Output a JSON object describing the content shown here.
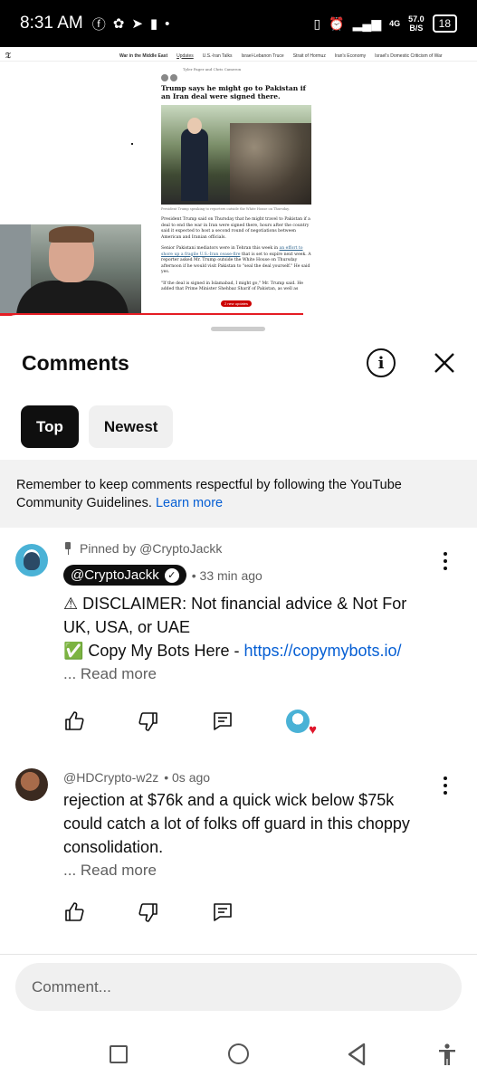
{
  "status_bar": {
    "time": "8:31 AM",
    "network": "4G",
    "speed_value": "57.0",
    "speed_unit": "B/S",
    "battery": "18"
  },
  "video": {
    "nyt_nav": [
      "War in the Middle East",
      "Updates",
      "U.S.-Iran Talks",
      "Israel-Lebanon Truce",
      "Strait of Hormuz",
      "Iran's Economy",
      "Israel's Domestic Criticism of War"
    ],
    "byline": "Tyler Pager and Chris Cameron",
    "headline": "Trump says he might go to Pakistan if an Iran deal were signed there.",
    "caption": "President Trump speaking to reporters outside the White House on Thursday.",
    "para1": "President Trump said on Thursday that he might travel to Pakistan if a deal to end the war in Iran were signed there, hours after the country said it expected to host a second round of negotiations between American and Iranian officials.",
    "para2_start": "Senior Pakistani mediators were in Tehran this week in ",
    "para2_link": "an effort to shore up a fragile U.S.-Iran cease-fire",
    "para2_end": " that is set to expire next week. A reporter asked Mr. Trump outside the White House on Thursday afternoon if he would visit Pakistan to \"seal the deal yourself.\" He said yes.",
    "para3": "\"If the deal is signed in Islamabad, I might go,\" Mr. Trump said. He added that Prime Minister Shehbaz Sharif of Pakistan, as well as",
    "new_updates": "2 new updates"
  },
  "sheet": {
    "title": "Comments",
    "chips": [
      "Top",
      "Newest"
    ],
    "notice_text": "Remember to keep comments respectful by following the YouTube Community Guidelines.",
    "notice_link": "Learn more"
  },
  "comments": [
    {
      "pinned_label": "Pinned by @CryptoJackk",
      "author": "@CryptoJackk",
      "time": "• 33 min ago",
      "line1": "⚠ DISCLAIMER: Not financial advice & Not For UK, USA, or UAE",
      "line2_prefix": "✅ Copy My Bots Here - ",
      "line2_url": "https://copymybots.io/",
      "read_more": "... Read more"
    },
    {
      "author": "@HDCrypto-w2z",
      "time": "• 0s ago",
      "text": "rejection at $76k and a quick wick below $75k could catch a lot of folks off guard in this choppy consolidation.",
      "read_more": " ... Read more"
    }
  ],
  "input": {
    "placeholder": "Comment..."
  },
  "colors": {
    "link": "#065fd4",
    "heart": "#e0162b",
    "chip_active": "#0f0f0f"
  }
}
